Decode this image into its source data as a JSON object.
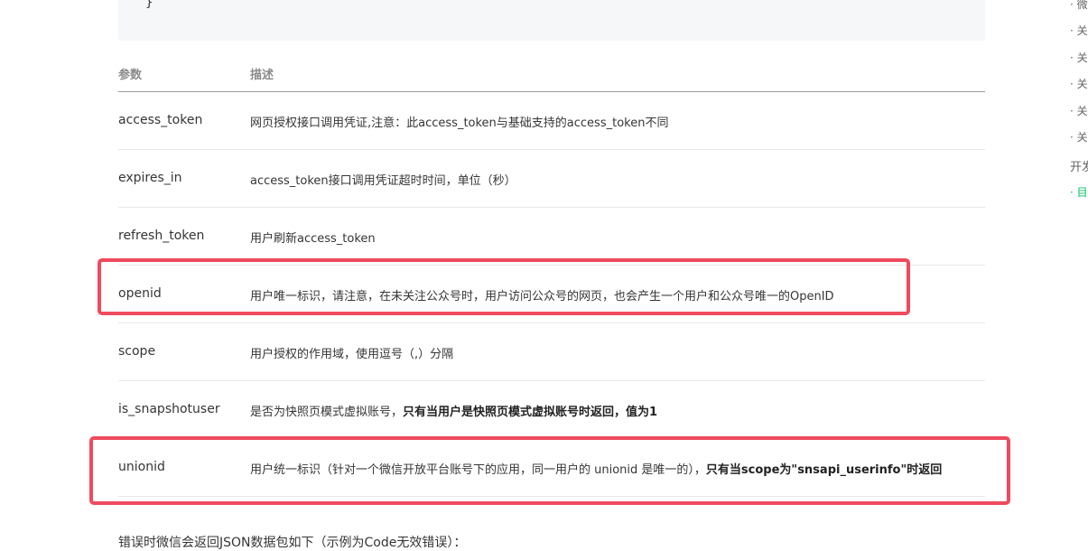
{
  "code": {
    "closing_brace": "}"
  },
  "table": {
    "headers": {
      "param": "参数",
      "desc": "描述"
    },
    "rows": [
      {
        "param": "access_token",
        "desc": "网页授权接口调用凭证,注意：此access_token与基础支持的access_token不同",
        "desc_bold": ""
      },
      {
        "param": "expires_in",
        "desc": "access_token接口调用凭证超时时间，单位（秒）",
        "desc_bold": ""
      },
      {
        "param": "refresh_token",
        "desc": "用户刷新access_token",
        "desc_bold": ""
      },
      {
        "param": "openid",
        "desc": "用户唯一标识，请注意，在未关注公众号时，用户访问公众号的网页，也会产生一个用户和公众号唯一的OpenID",
        "desc_bold": ""
      },
      {
        "param": "scope",
        "desc": "用户授权的作用域，使用逗号（,）分隔",
        "desc_bold": ""
      },
      {
        "param": "is_snapshotuser",
        "desc": "是否为快照页模式虚拟账号，",
        "desc_bold": "只有当用户是快照页模式虚拟账号时返回，值为1"
      },
      {
        "param": "unionid",
        "desc": "用户统一标识（针对一个微信开放平台账号下的应用，同一用户的 unionid 是唯一的），",
        "desc_bold": "只有当scope为\"snsapi_userinfo\"时返回"
      }
    ]
  },
  "sidebar": {
    "items": [
      "· 微",
      "· 关",
      "· 关",
      "· 关",
      "· 关",
      "· 关",
      "开发",
      "· 目"
    ]
  },
  "bottom_text": "错误时微信会返回JSON数据包如下（示例为Code无效错误）：",
  "colors": {
    "highlight": "#ef4a5e",
    "sidebar_active": "#07c160"
  }
}
